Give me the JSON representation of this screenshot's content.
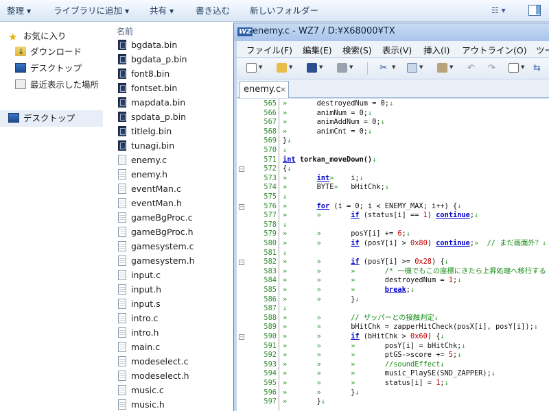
{
  "explorer": {
    "toolbar": {
      "organize": "整理",
      "add_to_library": "ライブラリに追加",
      "share": "共有",
      "burn": "書き込む",
      "new_folder": "新しいフォルダー"
    },
    "nav": {
      "favorites": "お気に入り",
      "downloads": "ダウンロード",
      "desktop_fav": "デスクトップ",
      "recent": "最近表示した場所",
      "desktop": "デスクトップ"
    },
    "column_name": "名前",
    "files": [
      {
        "name": "bgdata.bin",
        "type": "bin"
      },
      {
        "name": "bgdata_p.bin",
        "type": "bin"
      },
      {
        "name": "font8.bin",
        "type": "bin"
      },
      {
        "name": "fontset.bin",
        "type": "bin"
      },
      {
        "name": "mapdata.bin",
        "type": "bin"
      },
      {
        "name": "spdata_p.bin",
        "type": "bin"
      },
      {
        "name": "titlelg.bin",
        "type": "bin"
      },
      {
        "name": "tunagi.bin",
        "type": "bin"
      },
      {
        "name": "enemy.c",
        "type": "txt"
      },
      {
        "name": "enemy.h",
        "type": "txt"
      },
      {
        "name": "eventMan.c",
        "type": "txt"
      },
      {
        "name": "eventMan.h",
        "type": "txt"
      },
      {
        "name": "gameBgProc.c",
        "type": "txt"
      },
      {
        "name": "gameBgProc.h",
        "type": "txt"
      },
      {
        "name": "gamesystem.c",
        "type": "txt"
      },
      {
        "name": "gamesystem.h",
        "type": "txt"
      },
      {
        "name": "input.c",
        "type": "txt"
      },
      {
        "name": "input.h",
        "type": "txt"
      },
      {
        "name": "input.s",
        "type": "txt"
      },
      {
        "name": "intro.c",
        "type": "txt"
      },
      {
        "name": "intro.h",
        "type": "txt"
      },
      {
        "name": "main.c",
        "type": "txt"
      },
      {
        "name": "modeselect.c",
        "type": "txt"
      },
      {
        "name": "modeselect.h",
        "type": "txt"
      },
      {
        "name": "music.c",
        "type": "txt"
      },
      {
        "name": "music.h",
        "type": "txt"
      }
    ]
  },
  "editor": {
    "logo": "WZ",
    "title": "enemy.c - WZ7 / D:¥X68000¥TX",
    "menu": [
      "ファイル(F)",
      "編集(E)",
      "検索(S)",
      "表示(V)",
      "挿入(I)",
      "アウトライン(O)",
      "ツー"
    ],
    "tab": {
      "label": "enemy.c",
      "close": "×"
    },
    "lines": [
      {
        "n": "565",
        "fold": "",
        "code": [
          [
            "tab",
            "»\t"
          ],
          [
            "",
            "destroyedNum = 0;"
          ],
          [
            "eol",
            "↓"
          ]
        ]
      },
      {
        "n": "566",
        "fold": "",
        "code": [
          [
            "tab",
            "»\t"
          ],
          [
            "",
            "animNum = 0;"
          ],
          [
            "eol",
            "↓"
          ]
        ]
      },
      {
        "n": "567",
        "fold": "",
        "code": [
          [
            "tab",
            "»\t"
          ],
          [
            "",
            "animAddNum = 0;"
          ],
          [
            "eol",
            "↓"
          ]
        ]
      },
      {
        "n": "568",
        "fold": "",
        "code": [
          [
            "tab",
            "»\t"
          ],
          [
            "",
            "animCnt = 0;"
          ],
          [
            "eol",
            "↓"
          ]
        ]
      },
      {
        "n": "569",
        "fold": "",
        "code": [
          [
            "",
            "}"
          ],
          [
            "eol",
            "↓"
          ]
        ]
      },
      {
        "n": "570",
        "fold": "",
        "code": [
          [
            "eol",
            "↓"
          ]
        ]
      },
      {
        "n": "571",
        "fold": "",
        "code": [
          [
            "kw",
            "int"
          ],
          [
            "",
            " "
          ],
          [
            "fn",
            "torkan_moveDown()"
          ],
          [
            "eol",
            "↓"
          ]
        ]
      },
      {
        "n": "572",
        "fold": "minus",
        "code": [
          [
            "",
            "{"
          ],
          [
            "eol",
            "↓"
          ]
        ]
      },
      {
        "n": "573",
        "fold": "",
        "code": [
          [
            "tab",
            "»\t"
          ],
          [
            "kw",
            "int"
          ],
          [
            "tab",
            "»\t"
          ],
          [
            "",
            "i;"
          ],
          [
            "eol",
            "↓"
          ]
        ]
      },
      {
        "n": "574",
        "fold": "",
        "code": [
          [
            "tab",
            "»\t"
          ],
          [
            "",
            "BYTE"
          ],
          [
            "tab",
            "»\t"
          ],
          [
            "",
            "bHitChk;"
          ],
          [
            "eol",
            "↓"
          ]
        ]
      },
      {
        "n": "575",
        "fold": "",
        "code": [
          [
            "eol",
            "↓"
          ]
        ]
      },
      {
        "n": "576",
        "fold": "minus",
        "code": [
          [
            "tab",
            "»\t"
          ],
          [
            "kw",
            "for"
          ],
          [
            "",
            " (i = 0; i < ENEMY_MAX; i++) {"
          ],
          [
            "eol",
            "↓"
          ]
        ]
      },
      {
        "n": "577",
        "fold": "",
        "code": [
          [
            "tab",
            "»\t»\t"
          ],
          [
            "kw",
            "if"
          ],
          [
            "",
            " (status[i] == "
          ],
          [
            "num",
            "1"
          ],
          [
            "",
            ") "
          ],
          [
            "kw",
            "continue"
          ],
          [
            "",
            ";"
          ],
          [
            "eol",
            "↓"
          ]
        ]
      },
      {
        "n": "578",
        "fold": "",
        "code": [
          [
            "eol",
            "↓"
          ]
        ]
      },
      {
        "n": "579",
        "fold": "",
        "code": [
          [
            "tab",
            "»\t»\t"
          ],
          [
            "",
            "posY[i] += "
          ],
          [
            "num",
            "6"
          ],
          [
            "",
            ";"
          ],
          [
            "eol",
            "↓"
          ]
        ]
      },
      {
        "n": "580",
        "fold": "",
        "code": [
          [
            "tab",
            "»\t»\t"
          ],
          [
            "kw",
            "if"
          ],
          [
            "",
            " (posY[i] > "
          ],
          [
            "num",
            "0x80"
          ],
          [
            "",
            ") "
          ],
          [
            "kw",
            "continue"
          ],
          [
            "",
            ";"
          ],
          [
            "tab",
            "»\t"
          ],
          [
            "cm",
            "// まだ画面外？"
          ],
          [
            "eol",
            "↓"
          ]
        ]
      },
      {
        "n": "581",
        "fold": "",
        "code": [
          [
            "eol",
            "↓"
          ]
        ]
      },
      {
        "n": "582",
        "fold": "minus",
        "code": [
          [
            "tab",
            "»\t»\t"
          ],
          [
            "kw",
            "if"
          ],
          [
            "",
            " (posY[i] >= "
          ],
          [
            "num",
            "0x28"
          ],
          [
            "",
            ") {"
          ],
          [
            "eol",
            "↓"
          ]
        ]
      },
      {
        "n": "583",
        "fold": "",
        "code": [
          [
            "tab",
            "»\t»\t»\t"
          ],
          [
            "cm",
            "/* 一機でもこの座標にきたら上昇処理へ移行する */"
          ],
          [
            "eol",
            "↓"
          ]
        ]
      },
      {
        "n": "584",
        "fold": "",
        "code": [
          [
            "tab",
            "»\t»\t»\t"
          ],
          [
            "",
            "destroyedNum = "
          ],
          [
            "num",
            "1"
          ],
          [
            "",
            ";"
          ],
          [
            "eol",
            "↓"
          ]
        ]
      },
      {
        "n": "585",
        "fold": "",
        "code": [
          [
            "tab",
            "»\t»\t»\t"
          ],
          [
            "kw",
            "break"
          ],
          [
            "",
            ";"
          ],
          [
            "eol",
            "↓"
          ]
        ]
      },
      {
        "n": "586",
        "fold": "",
        "code": [
          [
            "tab",
            "»\t»\t"
          ],
          [
            "",
            "}"
          ],
          [
            "eol",
            "↓"
          ]
        ]
      },
      {
        "n": "587",
        "fold": "",
        "code": [
          [
            "eol",
            "↓"
          ]
        ]
      },
      {
        "n": "588",
        "fold": "",
        "code": [
          [
            "tab",
            "»\t»\t"
          ],
          [
            "cm",
            "// ザッパーとの接触判定"
          ],
          [
            "eol",
            "↓"
          ]
        ]
      },
      {
        "n": "589",
        "fold": "",
        "code": [
          [
            "tab",
            "»\t»\t"
          ],
          [
            "",
            "bHitChk = zapperHitCheck(posX[i], posY[i]);"
          ],
          [
            "eol",
            "↓"
          ]
        ]
      },
      {
        "n": "590",
        "fold": "minus",
        "code": [
          [
            "tab",
            "»\t»\t"
          ],
          [
            "kw",
            "if"
          ],
          [
            "",
            " (bHitChk > "
          ],
          [
            "num",
            "0x60"
          ],
          [
            "",
            ") {"
          ],
          [
            "eol",
            "↓"
          ]
        ]
      },
      {
        "n": "591",
        "fold": "",
        "code": [
          [
            "tab",
            "»\t»\t»\t"
          ],
          [
            "",
            "posY[i] = bHitChk;"
          ],
          [
            "eol",
            "↓"
          ]
        ]
      },
      {
        "n": "592",
        "fold": "",
        "code": [
          [
            "tab",
            "»\t»\t»\t"
          ],
          [
            "",
            "ptGS->score += "
          ],
          [
            "num",
            "5"
          ],
          [
            "",
            ";"
          ],
          [
            "eol",
            "↓"
          ]
        ]
      },
      {
        "n": "593",
        "fold": "",
        "code": [
          [
            "tab",
            "»\t»\t»\t"
          ],
          [
            "cm",
            "//soundEffect"
          ],
          [
            "eol",
            "↓"
          ]
        ]
      },
      {
        "n": "594",
        "fold": "",
        "code": [
          [
            "tab",
            "»\t»\t»\t"
          ],
          [
            "",
            "music_PlaySE(SND_ZAPPER);"
          ],
          [
            "eol",
            "↓"
          ]
        ]
      },
      {
        "n": "595",
        "fold": "",
        "code": [
          [
            "tab",
            "»\t»\t»\t"
          ],
          [
            "",
            "status[i] = "
          ],
          [
            "num",
            "1"
          ],
          [
            "",
            ";"
          ],
          [
            "eol",
            "↓"
          ]
        ]
      },
      {
        "n": "596",
        "fold": "",
        "code": [
          [
            "tab",
            "»\t»\t"
          ],
          [
            "",
            "}"
          ],
          [
            "eol",
            "↓"
          ]
        ]
      },
      {
        "n": "597",
        "fold": "",
        "code": [
          [
            "tab",
            "»\t"
          ],
          [
            "",
            "}"
          ],
          [
            "eol",
            "↓"
          ]
        ]
      }
    ]
  }
}
